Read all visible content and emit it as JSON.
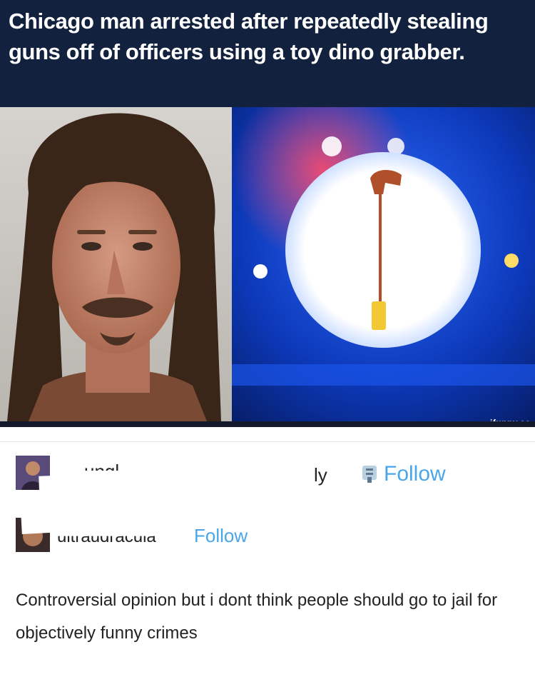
{
  "headline": {
    "text": "Chicago man arrested after repeatedly stealing guns off of officers using a toy dino grabber."
  },
  "images": {
    "mugshot": "mugshot-photo",
    "police": "police-lights-photo",
    "watermark": "ifunny.co"
  },
  "reblog": {
    "user1": {
      "name_visible_left": "unql",
      "name_visible_right": "ly",
      "follow_label": "Follow",
      "badge_icon": "tumblr-badge-icon"
    },
    "user2": {
      "name": "ultraudracula",
      "follow_label": "Follow"
    },
    "post_text": "Controversial opinion but i dont think people should go to jail for objectively funny crimes"
  },
  "colors": {
    "headline_bg": "#12213d",
    "follow": "#4aa6e8"
  }
}
